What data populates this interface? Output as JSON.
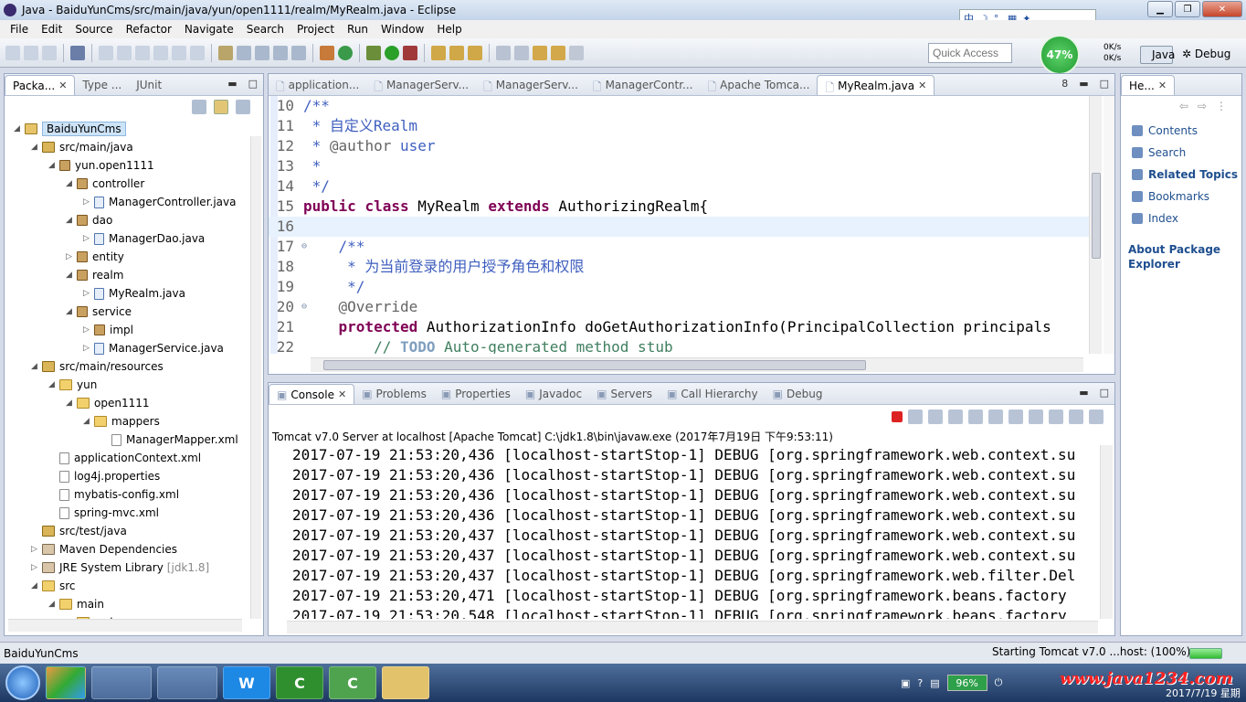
{
  "window": {
    "title": "Java - BaiduYunCms/src/main/java/yun/open1111/realm/MyRealm.java - Eclipse"
  },
  "menu": [
    "File",
    "Edit",
    "Source",
    "Refactor",
    "Navigate",
    "Search",
    "Project",
    "Run",
    "Window",
    "Help"
  ],
  "toolbar": {
    "quick_access": "Quick Access",
    "perf_percent": "47%",
    "up_speed": "0K/s",
    "down_speed": "0K/s",
    "perspective_java": "Java",
    "perspective_debug": "Debug"
  },
  "left_tabs": [
    {
      "label": "Packa...",
      "active": true
    },
    {
      "label": "Type ...",
      "active": false
    },
    {
      "label": "JUnit",
      "active": false
    }
  ],
  "tree": [
    {
      "label": "BaiduYunCms",
      "depth": 0,
      "icon": "project",
      "arrow": "down",
      "selected": true
    },
    {
      "label": "src/main/java",
      "depth": 1,
      "icon": "srcfolder",
      "arrow": "down"
    },
    {
      "label": "yun.open1111",
      "depth": 2,
      "icon": "package",
      "arrow": "down"
    },
    {
      "label": "controller",
      "depth": 3,
      "icon": "package",
      "arrow": "down"
    },
    {
      "label": "ManagerController.java",
      "depth": 4,
      "icon": "java",
      "arrow": "right"
    },
    {
      "label": "dao",
      "depth": 3,
      "icon": "package",
      "arrow": "down"
    },
    {
      "label": "ManagerDao.java",
      "depth": 4,
      "icon": "java",
      "arrow": "right"
    },
    {
      "label": "entity",
      "depth": 3,
      "icon": "package",
      "arrow": "right"
    },
    {
      "label": "realm",
      "depth": 3,
      "icon": "package",
      "arrow": "down"
    },
    {
      "label": "MyRealm.java",
      "depth": 4,
      "icon": "java",
      "arrow": "right"
    },
    {
      "label": "service",
      "depth": 3,
      "icon": "package",
      "arrow": "down"
    },
    {
      "label": "impl",
      "depth": 4,
      "icon": "package",
      "arrow": "right"
    },
    {
      "label": "ManagerService.java",
      "depth": 4,
      "icon": "java",
      "arrow": "right"
    },
    {
      "label": "src/main/resources",
      "depth": 1,
      "icon": "srcfolder",
      "arrow": "down"
    },
    {
      "label": "yun",
      "depth": 2,
      "icon": "folder",
      "arrow": "down"
    },
    {
      "label": "open1111",
      "depth": 3,
      "icon": "folder",
      "arrow": "down"
    },
    {
      "label": "mappers",
      "depth": 4,
      "icon": "folder",
      "arrow": "down"
    },
    {
      "label": "ManagerMapper.xml",
      "depth": 5,
      "icon": "xml",
      "arrow": ""
    },
    {
      "label": "applicationContext.xml",
      "depth": 2,
      "icon": "xml",
      "arrow": ""
    },
    {
      "label": "log4j.properties",
      "depth": 2,
      "icon": "xml",
      "arrow": ""
    },
    {
      "label": "mybatis-config.xml",
      "depth": 2,
      "icon": "xml",
      "arrow": ""
    },
    {
      "label": "spring-mvc.xml",
      "depth": 2,
      "icon": "xml",
      "arrow": ""
    },
    {
      "label": "src/test/java",
      "depth": 1,
      "icon": "srcfolder",
      "arrow": ""
    },
    {
      "label": "Maven Dependencies",
      "depth": 1,
      "icon": "lib",
      "arrow": "right"
    },
    {
      "label": "JRE System Library",
      "depth": 1,
      "icon": "lib",
      "arrow": "right",
      "suffix": "[jdk1.8]"
    },
    {
      "label": "src",
      "depth": 1,
      "icon": "folder",
      "arrow": "down"
    },
    {
      "label": "main",
      "depth": 2,
      "icon": "folder",
      "arrow": "down"
    },
    {
      "label": "webapp",
      "depth": 3,
      "icon": "folder",
      "arrow": "down"
    }
  ],
  "editor_tabs": [
    {
      "label": "application...",
      "active": false
    },
    {
      "label": "ManagerServ...",
      "active": false
    },
    {
      "label": "ManagerServ...",
      "active": false
    },
    {
      "label": "ManagerContr...",
      "active": false
    },
    {
      "label": "Apache Tomca...",
      "active": false
    },
    {
      "label": "MyRealm.java",
      "active": true
    }
  ],
  "editor_overflow": "8",
  "code": [
    {
      "n": "10",
      "parts": [
        [
          "jd",
          "/**"
        ]
      ],
      "fold": ""
    },
    {
      "n": "11",
      "parts": [
        [
          "jd",
          " * 自定义Realm"
        ]
      ],
      "fold": ""
    },
    {
      "n": "12",
      "parts": [
        [
          "jd",
          " * "
        ],
        [
          "ann",
          "@author"
        ],
        [
          "jd",
          " user"
        ]
      ],
      "fold": ""
    },
    {
      "n": "13",
      "parts": [
        [
          "jd",
          " *"
        ]
      ],
      "fold": ""
    },
    {
      "n": "14",
      "parts": [
        [
          "jd",
          " */"
        ]
      ],
      "fold": ""
    },
    {
      "n": "15",
      "parts": [
        [
          "kw",
          "public"
        ],
        [
          "",
          " "
        ],
        [
          "kw",
          "class"
        ],
        [
          "",
          " MyRealm "
        ],
        [
          "kw",
          "extends"
        ],
        [
          "",
          " AuthorizingRealm{"
        ]
      ],
      "fold": ""
    },
    {
      "n": "16",
      "parts": [
        [
          "",
          ""
        ]
      ],
      "fold": "",
      "current": true
    },
    {
      "n": "17",
      "parts": [
        [
          "jd",
          "    /**"
        ]
      ],
      "fold": "⊖"
    },
    {
      "n": "18",
      "parts": [
        [
          "jd",
          "     * 为当前登录的用户授予角色和权限"
        ]
      ],
      "fold": ""
    },
    {
      "n": "19",
      "parts": [
        [
          "jd",
          "     */"
        ]
      ],
      "fold": ""
    },
    {
      "n": "20",
      "parts": [
        [
          "ann",
          "    @Override"
        ]
      ],
      "fold": "⊖"
    },
    {
      "n": "21",
      "parts": [
        [
          "kw",
          "    protected"
        ],
        [
          "",
          " AuthorizationInfo doGetAuthorizationInfo(PrincipalCollection principals"
        ]
      ],
      "fold": ""
    },
    {
      "n": "22",
      "parts": [
        [
          "cm",
          "        // "
        ],
        [
          "todo",
          "TODO"
        ],
        [
          "cm",
          " Auto-generated method stub"
        ]
      ],
      "fold": ""
    }
  ],
  "bottom_tabs": [
    {
      "label": "Console",
      "active": true
    },
    {
      "label": "Problems",
      "active": false
    },
    {
      "label": "Properties",
      "active": false
    },
    {
      "label": "Javadoc",
      "active": false
    },
    {
      "label": "Servers",
      "active": false
    },
    {
      "label": "Call Hierarchy",
      "active": false
    },
    {
      "label": "Debug",
      "active": false
    }
  ],
  "console": {
    "label": "Tomcat v7.0 Server at localhost [Apache Tomcat] C:\\jdk1.8\\bin\\javaw.exe (2017年7月19日 下午9:53:11)",
    "lines": [
      "2017-07-19 21:53:20,436 [localhost-startStop-1] DEBUG [org.springframework.web.context.su",
      "2017-07-19 21:53:20,436 [localhost-startStop-1] DEBUG [org.springframework.web.context.su",
      "2017-07-19 21:53:20,436 [localhost-startStop-1] DEBUG [org.springframework.web.context.su",
      "2017-07-19 21:53:20,436 [localhost-startStop-1] DEBUG [org.springframework.web.context.su",
      "2017-07-19 21:53:20,437 [localhost-startStop-1] DEBUG [org.springframework.web.context.su",
      "2017-07-19 21:53:20,437 [localhost-startStop-1] DEBUG [org.springframework.web.context.su",
      "2017-07-19 21:53:20,437 [localhost-startStop-1] DEBUG [org.springframework.web.filter.Del",
      "2017-07-19 21:53:20,471 [localhost-startStop-1] DEBUG [org.springframework.beans.factory",
      "2017-07-19 21:53:20,548 [localhost-startStop-1] DEBUG [org.springframework.beans.factory"
    ]
  },
  "help": {
    "tab": "He...",
    "items": [
      {
        "label": "Contents",
        "bold": false
      },
      {
        "label": "Search",
        "bold": false
      },
      {
        "label": "Related Topics",
        "bold": true
      },
      {
        "label": "Bookmarks",
        "bold": false
      },
      {
        "label": "Index",
        "bold": false
      }
    ],
    "about": "About Package Explorer"
  },
  "status": {
    "left": "BaiduYunCms",
    "right": "Starting Tomcat v7.0 ...host: (100%)"
  },
  "taskbar": {
    "battery": "96%",
    "watermark": "www.java1234.com",
    "date": "2017/7/19 星期三"
  }
}
